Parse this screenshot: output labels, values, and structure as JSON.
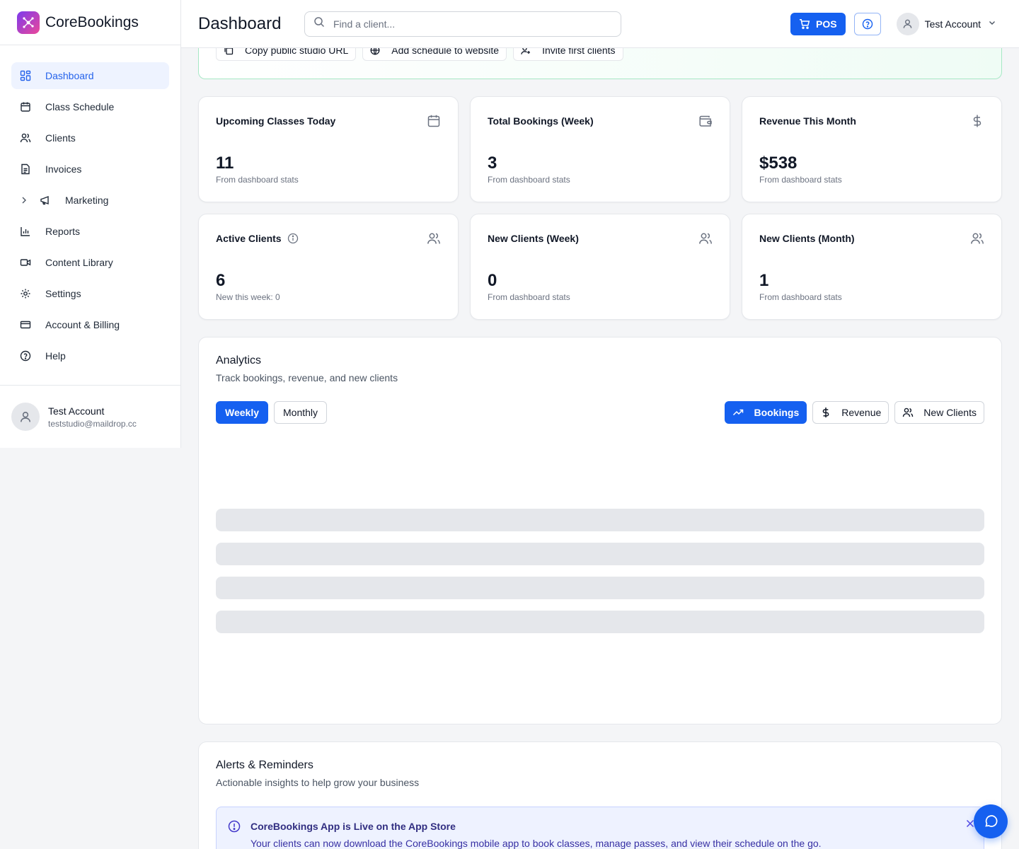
{
  "brand": {
    "name": "CoreBookings"
  },
  "sidebar": {
    "items": [
      {
        "label": "Dashboard"
      },
      {
        "label": "Class Schedule"
      },
      {
        "label": "Clients"
      },
      {
        "label": "Invoices"
      },
      {
        "label": "Marketing"
      },
      {
        "label": "Reports"
      },
      {
        "label": "Content Library"
      },
      {
        "label": "Settings"
      },
      {
        "label": "Account & Billing"
      },
      {
        "label": "Help"
      }
    ],
    "user": {
      "name": "Test Account",
      "email": "teststudio@maildrop.cc"
    }
  },
  "header": {
    "title": "Dashboard",
    "search_placeholder": "Find a client...",
    "pos_label": "POS",
    "account_name": "Test Account"
  },
  "banner": {
    "actions": [
      {
        "label": "Copy public studio URL"
      },
      {
        "label": "Add schedule to website"
      },
      {
        "label": "Invite first clients"
      }
    ]
  },
  "stats": [
    {
      "title": "Upcoming Classes Today",
      "value": "11",
      "sub": "From dashboard stats",
      "icon": "calendar-icon"
    },
    {
      "title": "Total Bookings (Week)",
      "value": "3",
      "sub": "From dashboard stats",
      "icon": "wallet-icon"
    },
    {
      "title": "Revenue This Month",
      "value": "$538",
      "sub": "From dashboard stats",
      "icon": "dollar-icon"
    },
    {
      "title": "Active Clients",
      "value": "6",
      "sub": "New this week: 0",
      "icon": "users-icon"
    },
    {
      "title": "New Clients (Week)",
      "value": "0",
      "sub": "From dashboard stats",
      "icon": "users-icon"
    },
    {
      "title": "New Clients (Month)",
      "value": "1",
      "sub": "From dashboard stats",
      "icon": "users-icon"
    }
  ],
  "analytics": {
    "title": "Analytics",
    "subtitle": "Track bookings, revenue, and new clients",
    "periods": [
      {
        "label": "Weekly"
      },
      {
        "label": "Monthly"
      }
    ],
    "selected_period": "Weekly",
    "metrics": [
      {
        "label": "Bookings"
      },
      {
        "label": "Revenue"
      },
      {
        "label": "New Clients"
      }
    ],
    "selected_metric": "Bookings"
  },
  "alerts": {
    "title": "Alerts & Reminders",
    "subtitle": "Actionable insights to help grow your business",
    "items": [
      {
        "title": "CoreBookings App is Live on the App Store",
        "text": "Your clients can now download the CoreBookings mobile app to book classes, manage passes, and view their schedule on the go."
      }
    ]
  },
  "colors": {
    "primary": "#1560f0",
    "active_nav_bg": "#eef3ff",
    "banner_border": "#a7e8c5",
    "skeleton": "#e5e7eb"
  }
}
